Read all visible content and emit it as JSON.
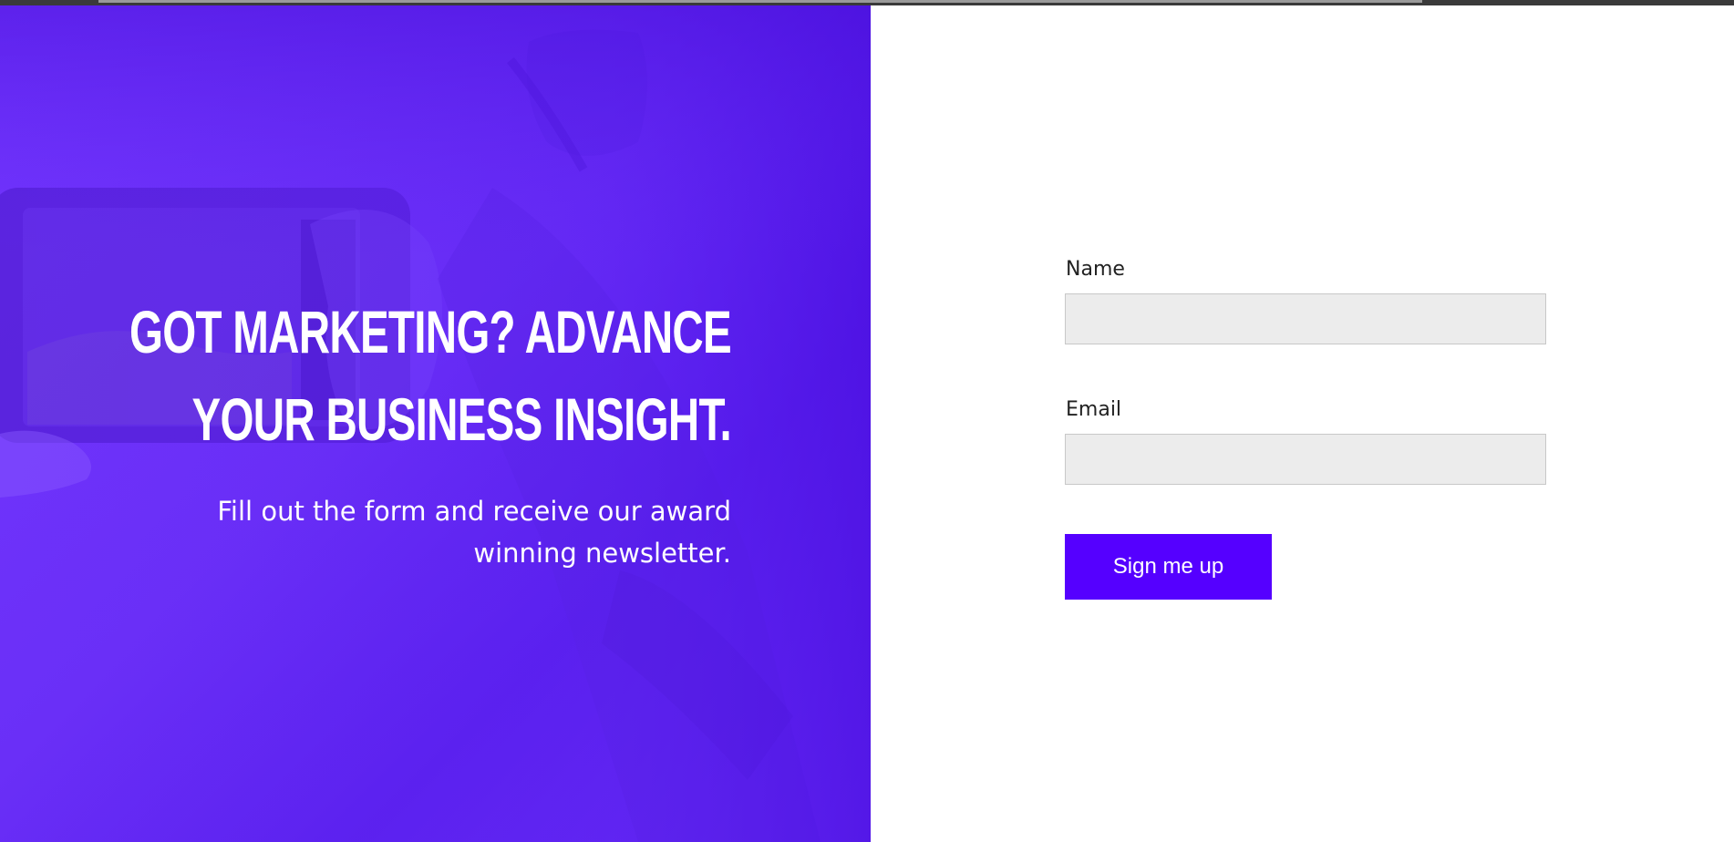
{
  "hero": {
    "headline_line1": "GOT MARKETING? ADVANCE",
    "headline_line2": "YOUR BUSINESS INSIGHT.",
    "subtext_line1": "Fill out the form and receive our award",
    "subtext_line2": "winning newsletter."
  },
  "form": {
    "name_label": "Name",
    "name_value": "",
    "email_label": "Email",
    "email_value": "",
    "submit_label": "Sign me up"
  },
  "colors": {
    "hero_overlay": "#6a2ff7",
    "accent_button": "#5500ff",
    "input_background": "#ececec",
    "input_border": "#c8c8c8"
  }
}
